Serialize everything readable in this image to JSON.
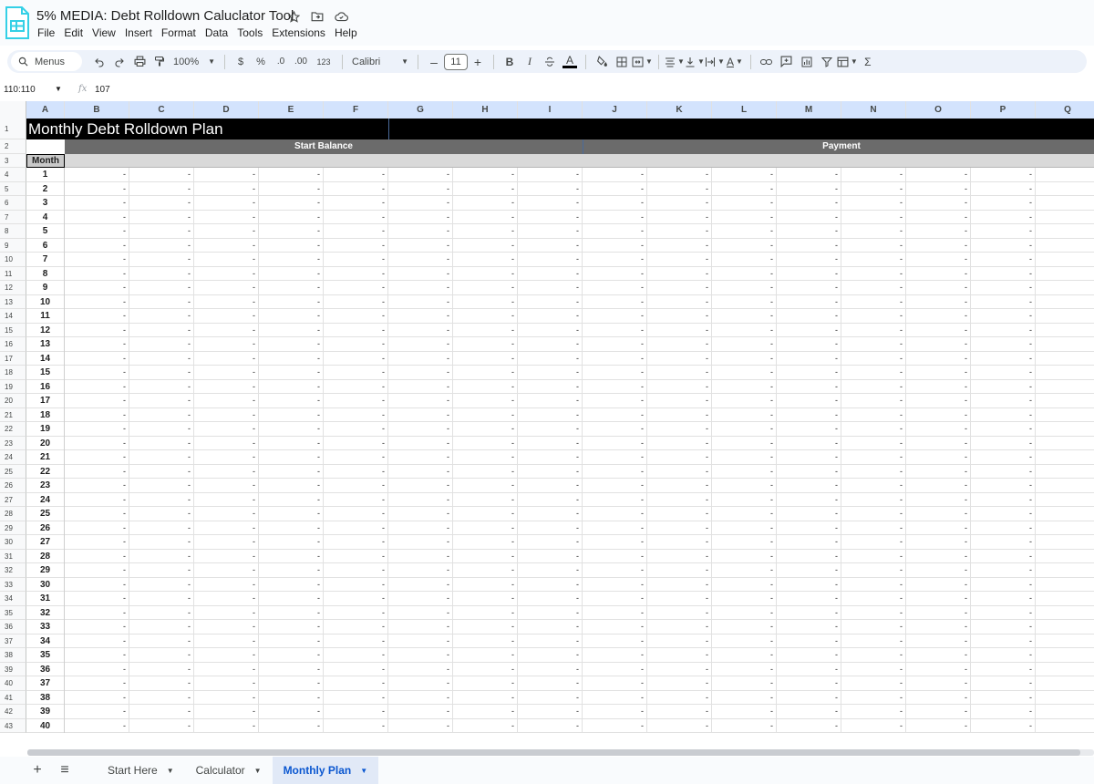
{
  "window": {
    "doc_title": "5% MEDIA: Debt Rolldown Caluclator Tool",
    "icons": [
      "star-icon",
      "move-to-folder-icon",
      "cloud-saved-icon"
    ]
  },
  "menu": [
    "File",
    "Edit",
    "View",
    "Insert",
    "Format",
    "Data",
    "Tools",
    "Extensions",
    "Help"
  ],
  "toolbar": {
    "search_label": "Menus",
    "zoom": "100%",
    "currency": "$",
    "percent": "%",
    "decrease_decimals": ".0",
    "increase_decimals": ".00",
    "number_format": "123",
    "font": "Calibri",
    "font_size": "11",
    "minus": "–",
    "plus": "+",
    "bold": "B",
    "italic": "I",
    "text_color": "A",
    "text_color_value": "#000000",
    "sum": "Σ"
  },
  "formula_bar": {
    "name_box": "110:110",
    "fx": "fx",
    "value": "107"
  },
  "columns": [
    "A",
    "B",
    "C",
    "D",
    "E",
    "F",
    "G",
    "H",
    "I",
    "J",
    "K",
    "L",
    "M",
    "N",
    "O",
    "P",
    "Q"
  ],
  "sheet": {
    "title": "Monthly Debt Rolldown Plan",
    "group_start_balance": "Start Balance",
    "group_payment": "Payment",
    "month_header": "Month",
    "empty_value": "-",
    "row_numbers": [
      "1",
      "2",
      "3",
      "4",
      "5",
      "6",
      "7",
      "8",
      "9",
      "10",
      "11",
      "12",
      "13",
      "14",
      "15",
      "16",
      "17",
      "18",
      "19",
      "20",
      "21",
      "22",
      "23",
      "24",
      "25",
      "26",
      "27",
      "28",
      "29",
      "30",
      "31",
      "32",
      "33",
      "34",
      "35",
      "36",
      "37",
      "38",
      "39",
      "40",
      "41",
      "42",
      "43"
    ],
    "months": [
      "1",
      "2",
      "3",
      "4",
      "5",
      "6",
      "7",
      "8",
      "9",
      "10",
      "11",
      "12",
      "13",
      "14",
      "15",
      "16",
      "17",
      "18",
      "19",
      "20",
      "21",
      "22",
      "23",
      "24",
      "25",
      "26",
      "27",
      "28",
      "29",
      "30",
      "31",
      "32",
      "33",
      "34",
      "35",
      "36",
      "37",
      "38",
      "39",
      "40"
    ]
  },
  "tabs": {
    "add": "+",
    "list": "≡",
    "items": [
      {
        "label": "Start Here",
        "active": false
      },
      {
        "label": "Calculator",
        "active": false
      },
      {
        "label": "Monthly Plan",
        "active": true
      }
    ]
  },
  "colors": {
    "header_black": "#000000",
    "group_gray": "#6b6b6b",
    "sub_gray": "#d9d9d9",
    "active_tab": "#0b57d0"
  }
}
